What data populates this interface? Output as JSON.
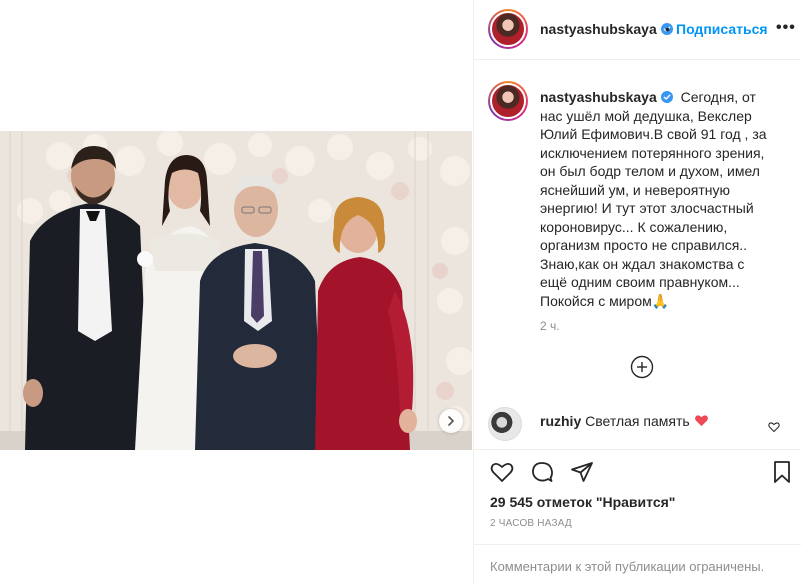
{
  "post": {
    "username": "nastyashubskaya",
    "follow_label": "Подписаться",
    "separator": "•",
    "more_label": "•••",
    "caption": "Сегодня, от нас ушёл мой дедушка, Векслер Юлий Ефимович.В свой 91 год , за исключением потерянного зрения, он был бодр телом и духом, имел яснейший ум, и невероятную энергию! И тут этот злосчастный короновирус... К сожалению, организм просто не справился.. Знаю,как он ждал знакомства с ещё одним своим правнуком... Покойся с миром🙏",
    "caption_time": "2 ч.",
    "likes": "29 545 отметок \"Нравится\"",
    "posted_ago": "2 часов назад",
    "comments_limited": "Комментарии к этой публикации ограничены."
  },
  "comments": [
    {
      "username": "ruzhiy",
      "text": "Светлая память",
      "emoji": "heart"
    }
  ],
  "icons": {
    "verified": "verified-badge-icon",
    "like": "heart-icon",
    "comment": "comment-icon",
    "share": "share-icon",
    "save": "bookmark-icon",
    "load_more": "plus-circle-icon",
    "next": "chevron-right-icon"
  },
  "colors": {
    "accent": "#0095f6",
    "verified": "#3897f0",
    "text": "#262626",
    "muted": "#8e8e8e",
    "heart_emoji": "#ed4956"
  }
}
